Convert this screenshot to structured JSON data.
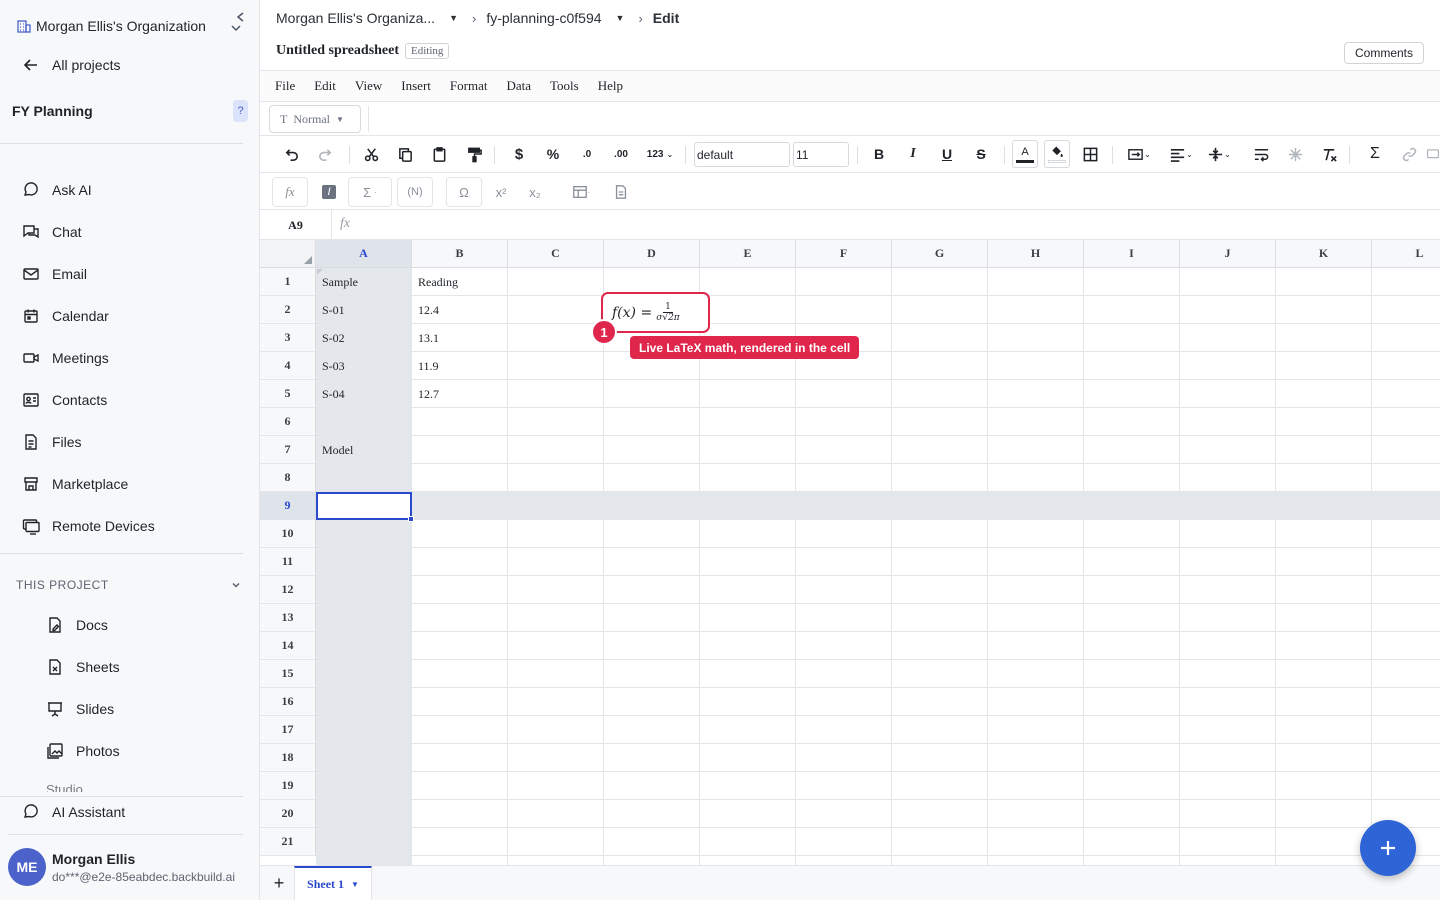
{
  "sidebar": {
    "org_name": "Morgan Ellis's Organization",
    "all_projects": "All projects",
    "project_name": "FY Planning",
    "help_badge": "?",
    "nav": [
      {
        "label": "Ask AI",
        "icon": "chat-bubble-icon"
      },
      {
        "label": "Chat",
        "icon": "chat-icon"
      },
      {
        "label": "Email",
        "icon": "mail-icon"
      },
      {
        "label": "Calendar",
        "icon": "calendar-icon"
      },
      {
        "label": "Meetings",
        "icon": "video-icon"
      },
      {
        "label": "Contacts",
        "icon": "contact-card-icon"
      },
      {
        "label": "Files",
        "icon": "file-icon"
      },
      {
        "label": "Marketplace",
        "icon": "store-icon"
      },
      {
        "label": "Remote Devices",
        "icon": "monitor-icon"
      }
    ],
    "section_title": "THIS PROJECT",
    "project_items": [
      {
        "label": "Docs",
        "icon": "doc-icon"
      },
      {
        "label": "Sheets",
        "icon": "sheet-icon"
      },
      {
        "label": "Slides",
        "icon": "slides-icon"
      },
      {
        "label": "Photos",
        "icon": "photo-icon"
      }
    ],
    "truncated_item": "Studio",
    "ai_assistant": "AI Assistant",
    "user": {
      "initials": "ME",
      "name": "Morgan Ellis",
      "email": "do***@e2e-85eabdec.backbuild.ai"
    }
  },
  "header": {
    "breadcrumb_org": "Morgan Ellis's Organiza...",
    "breadcrumb_project": "fy-planning-c0f594",
    "breadcrumb_current": "Edit",
    "doc_title": "Untitled spreadsheet",
    "doc_status": "Editing",
    "comments_label": "Comments"
  },
  "menu": [
    "File",
    "Edit",
    "View",
    "Insert",
    "Format",
    "Data",
    "Tools",
    "Help"
  ],
  "style_select": "Normal",
  "toolbar": {
    "font_family": "default",
    "font_size": "11",
    "currency": "$",
    "percent": "%",
    "dec_decrease": ".0",
    "dec_increase": ".00",
    "number_format": "123",
    "text_color_glyph": "A",
    "sum_glyph": "Σ"
  },
  "formula_tools": {
    "fx": "fx",
    "sum": "Σ",
    "named": "(N)",
    "omega": "Ω",
    "superscript": "x²",
    "subscript": "x₂"
  },
  "namebox": "A9",
  "fx_label": "fx",
  "grid": {
    "columns": [
      "A",
      "B",
      "C",
      "D",
      "E",
      "F",
      "G",
      "H",
      "I",
      "J",
      "K",
      "L"
    ],
    "rows": [
      "1",
      "2",
      "3",
      "4",
      "5",
      "6",
      "7",
      "8",
      "9",
      "10",
      "11",
      "12",
      "13",
      "14",
      "15",
      "16",
      "17",
      "18",
      "19",
      "20",
      "21"
    ],
    "selected_column": "A",
    "selected_row": "9",
    "cells": {
      "A1": "Sample",
      "B1": "Reading",
      "A2": "S-01",
      "B2": "12.4",
      "A3": "S-02",
      "B3": "13.1",
      "A4": "S-03",
      "B4": "11.9",
      "A5": "S-04",
      "B5": "12.7",
      "A7": "Model"
    },
    "latex": {
      "lhs": "f(x) = ",
      "numerator": "1",
      "denominator": "σ√2π"
    }
  },
  "annotation": {
    "number": "1",
    "text": "Live LaTeX math, rendered in the cell"
  },
  "sheet_tabs": {
    "add": "+",
    "active": "Sheet 1"
  },
  "colors": {
    "accent": "#2b4acb",
    "annotation": "#e0264b",
    "fab": "#2f64d6"
  }
}
